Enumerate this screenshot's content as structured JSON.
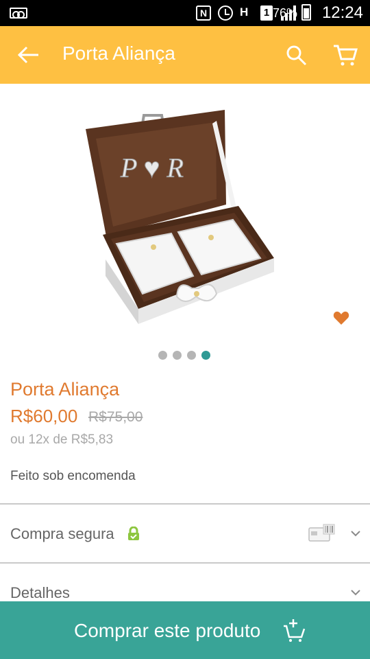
{
  "status_bar": {
    "battery": "76%",
    "time": "12:24",
    "icons": [
      "voicemail-icon",
      "nfc-icon",
      "alarm-icon",
      "hplus-icon",
      "sim-icon",
      "signal-icon",
      "battery-icon"
    ]
  },
  "app_bar": {
    "title": "Porta Aliança",
    "icons": [
      "back-arrow-icon",
      "search-icon",
      "cart-icon"
    ]
  },
  "gallery": {
    "image_alt": "ring box",
    "monogram": "P ♥ R",
    "dots_count": 4,
    "active_dot": 4,
    "favorite_icon": "heart-icon"
  },
  "product": {
    "title": "Porta Aliança",
    "price": "R$60,00",
    "old_price": "R$75,00",
    "installments": "ou 12x de R$5,83",
    "availability": "Feito sob encomenda"
  },
  "sections": [
    {
      "label": "Compra segura",
      "icons": [
        "lock-icon",
        "credit-card-icon",
        "chevron-down-icon"
      ]
    },
    {
      "label": "Detalhes",
      "icons": [
        "chevron-down-icon"
      ]
    }
  ],
  "cta": {
    "label": "Comprar este produto",
    "icon": "add-to-cart-icon"
  },
  "colors": {
    "app_bar": "#fec042",
    "accent": "#e07a2f",
    "cta": "#39a497",
    "active_dot": "#2f9a95",
    "lock": "#8dc63f"
  }
}
